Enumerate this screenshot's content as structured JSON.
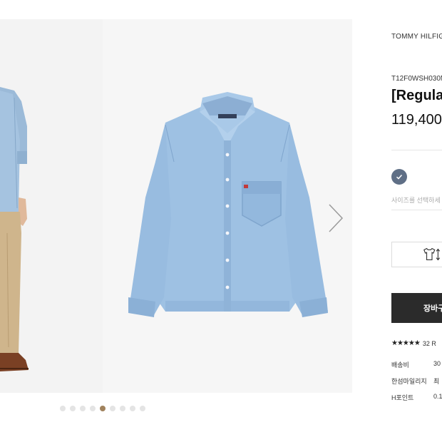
{
  "gallery": {
    "pagination": {
      "total": 9,
      "active_index": 4
    }
  },
  "product": {
    "brand": "TOMMY HILFIGE",
    "code": "T12F0WSH030M",
    "title": "[Regula",
    "price": "119,400",
    "size_placeholder": "사이즈를 선택하세",
    "cart_label": "장바구",
    "reviews": "32 R",
    "rating_stars": "★★★★★",
    "swatch_color": "#5f6f86"
  },
  "details": [
    {
      "label": "배송비",
      "value": "30"
    },
    {
      "label": "한섬마일리지",
      "value": "최"
    },
    {
      "label": "H포인트",
      "value": "0.1"
    }
  ]
}
